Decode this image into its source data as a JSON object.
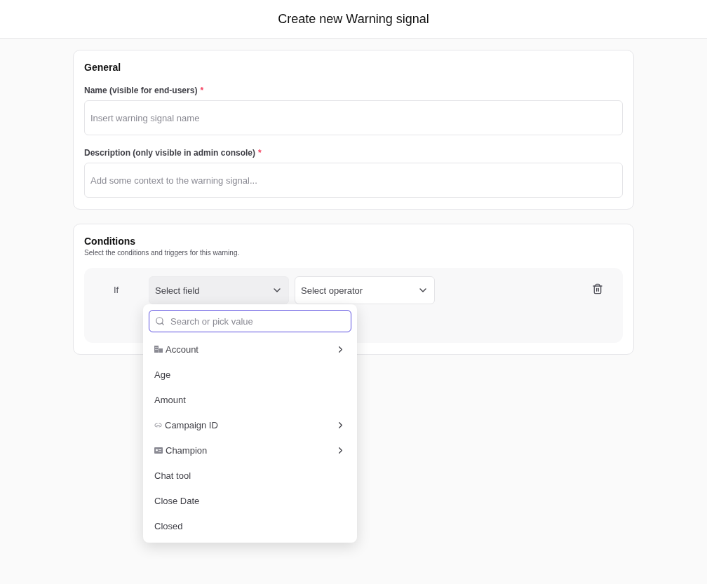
{
  "header": {
    "title": "Create new Warning signal"
  },
  "general": {
    "title": "General",
    "fields": [
      {
        "label": "Name (visible for end-users)",
        "required_mark": "*",
        "placeholder": "Insert warning signal name"
      },
      {
        "label": "Description (only visible in admin console)",
        "required_mark": "*",
        "placeholder": "Add some context to the warning signal..."
      }
    ]
  },
  "conditions": {
    "title": "Conditions",
    "subtitle": "Select the conditions and triggers for this warning.",
    "rows": [
      {
        "prefix": "If",
        "field": {
          "placeholder": "Select field",
          "open": true
        },
        "operator": {
          "placeholder": "Select operator"
        }
      }
    ]
  },
  "dropdown": {
    "search_placeholder": "Search or pick value",
    "items": [
      {
        "label": "Account",
        "kind": "building",
        "submenu": true
      },
      {
        "label": "Age",
        "kind": "plain",
        "submenu": false
      },
      {
        "label": "Amount",
        "kind": "plain",
        "submenu": false
      },
      {
        "label": "Campaign ID",
        "kind": "link",
        "submenu": true
      },
      {
        "label": "Champion",
        "kind": "card",
        "submenu": true
      },
      {
        "label": "Chat tool",
        "kind": "plain",
        "submenu": false
      },
      {
        "label": "Close Date",
        "kind": "plain",
        "submenu": false
      },
      {
        "label": "Closed",
        "kind": "plain",
        "submenu": false
      }
    ]
  }
}
